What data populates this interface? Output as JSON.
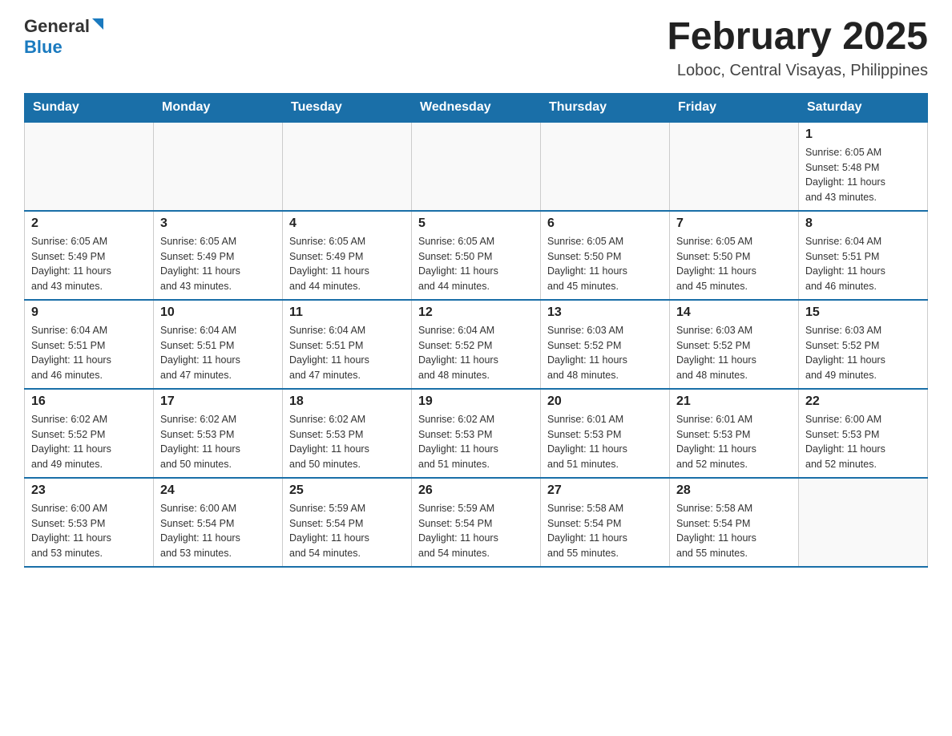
{
  "header": {
    "logo_general": "General",
    "logo_blue": "Blue",
    "month_title": "February 2025",
    "location": "Loboc, Central Visayas, Philippines"
  },
  "weekdays": [
    "Sunday",
    "Monday",
    "Tuesday",
    "Wednesday",
    "Thursday",
    "Friday",
    "Saturday"
  ],
  "weeks": [
    [
      {
        "day": "",
        "info": ""
      },
      {
        "day": "",
        "info": ""
      },
      {
        "day": "",
        "info": ""
      },
      {
        "day": "",
        "info": ""
      },
      {
        "day": "",
        "info": ""
      },
      {
        "day": "",
        "info": ""
      },
      {
        "day": "1",
        "info": "Sunrise: 6:05 AM\nSunset: 5:48 PM\nDaylight: 11 hours\nand 43 minutes."
      }
    ],
    [
      {
        "day": "2",
        "info": "Sunrise: 6:05 AM\nSunset: 5:49 PM\nDaylight: 11 hours\nand 43 minutes."
      },
      {
        "day": "3",
        "info": "Sunrise: 6:05 AM\nSunset: 5:49 PM\nDaylight: 11 hours\nand 43 minutes."
      },
      {
        "day": "4",
        "info": "Sunrise: 6:05 AM\nSunset: 5:49 PM\nDaylight: 11 hours\nand 44 minutes."
      },
      {
        "day": "5",
        "info": "Sunrise: 6:05 AM\nSunset: 5:50 PM\nDaylight: 11 hours\nand 44 minutes."
      },
      {
        "day": "6",
        "info": "Sunrise: 6:05 AM\nSunset: 5:50 PM\nDaylight: 11 hours\nand 45 minutes."
      },
      {
        "day": "7",
        "info": "Sunrise: 6:05 AM\nSunset: 5:50 PM\nDaylight: 11 hours\nand 45 minutes."
      },
      {
        "day": "8",
        "info": "Sunrise: 6:04 AM\nSunset: 5:51 PM\nDaylight: 11 hours\nand 46 minutes."
      }
    ],
    [
      {
        "day": "9",
        "info": "Sunrise: 6:04 AM\nSunset: 5:51 PM\nDaylight: 11 hours\nand 46 minutes."
      },
      {
        "day": "10",
        "info": "Sunrise: 6:04 AM\nSunset: 5:51 PM\nDaylight: 11 hours\nand 47 minutes."
      },
      {
        "day": "11",
        "info": "Sunrise: 6:04 AM\nSunset: 5:51 PM\nDaylight: 11 hours\nand 47 minutes."
      },
      {
        "day": "12",
        "info": "Sunrise: 6:04 AM\nSunset: 5:52 PM\nDaylight: 11 hours\nand 48 minutes."
      },
      {
        "day": "13",
        "info": "Sunrise: 6:03 AM\nSunset: 5:52 PM\nDaylight: 11 hours\nand 48 minutes."
      },
      {
        "day": "14",
        "info": "Sunrise: 6:03 AM\nSunset: 5:52 PM\nDaylight: 11 hours\nand 48 minutes."
      },
      {
        "day": "15",
        "info": "Sunrise: 6:03 AM\nSunset: 5:52 PM\nDaylight: 11 hours\nand 49 minutes."
      }
    ],
    [
      {
        "day": "16",
        "info": "Sunrise: 6:02 AM\nSunset: 5:52 PM\nDaylight: 11 hours\nand 49 minutes."
      },
      {
        "day": "17",
        "info": "Sunrise: 6:02 AM\nSunset: 5:53 PM\nDaylight: 11 hours\nand 50 minutes."
      },
      {
        "day": "18",
        "info": "Sunrise: 6:02 AM\nSunset: 5:53 PM\nDaylight: 11 hours\nand 50 minutes."
      },
      {
        "day": "19",
        "info": "Sunrise: 6:02 AM\nSunset: 5:53 PM\nDaylight: 11 hours\nand 51 minutes."
      },
      {
        "day": "20",
        "info": "Sunrise: 6:01 AM\nSunset: 5:53 PM\nDaylight: 11 hours\nand 51 minutes."
      },
      {
        "day": "21",
        "info": "Sunrise: 6:01 AM\nSunset: 5:53 PM\nDaylight: 11 hours\nand 52 minutes."
      },
      {
        "day": "22",
        "info": "Sunrise: 6:00 AM\nSunset: 5:53 PM\nDaylight: 11 hours\nand 52 minutes."
      }
    ],
    [
      {
        "day": "23",
        "info": "Sunrise: 6:00 AM\nSunset: 5:53 PM\nDaylight: 11 hours\nand 53 minutes."
      },
      {
        "day": "24",
        "info": "Sunrise: 6:00 AM\nSunset: 5:54 PM\nDaylight: 11 hours\nand 53 minutes."
      },
      {
        "day": "25",
        "info": "Sunrise: 5:59 AM\nSunset: 5:54 PM\nDaylight: 11 hours\nand 54 minutes."
      },
      {
        "day": "26",
        "info": "Sunrise: 5:59 AM\nSunset: 5:54 PM\nDaylight: 11 hours\nand 54 minutes."
      },
      {
        "day": "27",
        "info": "Sunrise: 5:58 AM\nSunset: 5:54 PM\nDaylight: 11 hours\nand 55 minutes."
      },
      {
        "day": "28",
        "info": "Sunrise: 5:58 AM\nSunset: 5:54 PM\nDaylight: 11 hours\nand 55 minutes."
      },
      {
        "day": "",
        "info": ""
      }
    ]
  ]
}
